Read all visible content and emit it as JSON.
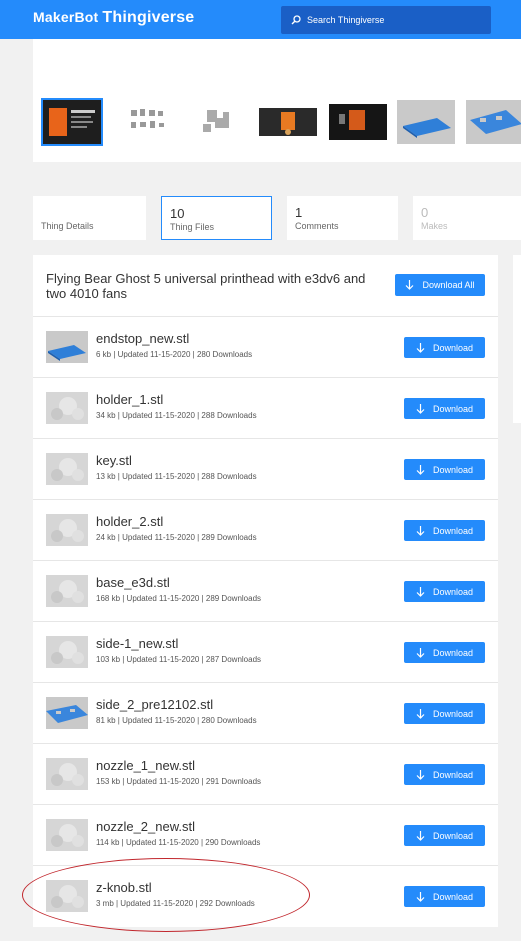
{
  "header": {
    "logo_maker": "MakerBot",
    "logo_thing": "Thingiverse",
    "search_placeholder": "Search Thingiverse",
    "brand_color": "#248bfb"
  },
  "gallery": {
    "thumbnails": [
      "photo-card",
      "parts-grid",
      "parts-render",
      "orange-printhead-photo",
      "printhead-dark-photo",
      "blue-part-render",
      "blue-plate-render"
    ]
  },
  "tabs": [
    {
      "count": "",
      "label": "Thing Details"
    },
    {
      "count": "10",
      "label": "Thing Files"
    },
    {
      "count": "1",
      "label": "Comments"
    },
    {
      "count": "0",
      "label": "Makes"
    }
  ],
  "files": {
    "title": "Flying Bear Ghost 5 universal printhead with e3dv6 and two 4010 fans",
    "download_all_label": "Download All",
    "download_label": "Download",
    "items": [
      {
        "name": "endstop_new.stl",
        "meta": "6 kb | Updated 11-15-2020 | 280 Downloads",
        "thumb": "blue-part"
      },
      {
        "name": "holder_1.stl",
        "meta": "34 kb | Updated 11-15-2020 | 288 Downloads",
        "thumb": "placeholder"
      },
      {
        "name": "key.stl",
        "meta": "13 kb | Updated 11-15-2020 | 288 Downloads",
        "thumb": "placeholder"
      },
      {
        "name": "holder_2.stl",
        "meta": "24 kb | Updated 11-15-2020 | 289 Downloads",
        "thumb": "placeholder"
      },
      {
        "name": "base_e3d.stl",
        "meta": "168 kb | Updated 11-15-2020 | 289 Downloads",
        "thumb": "placeholder"
      },
      {
        "name": "side-1_new.stl",
        "meta": "103 kb | Updated 11-15-2020 | 287 Downloads",
        "thumb": "placeholder"
      },
      {
        "name": "side_2_pre12102.stl",
        "meta": "81 kb | Updated 11-15-2020 | 280 Downloads",
        "thumb": "blue-plate"
      },
      {
        "name": "nozzle_1_new.stl",
        "meta": "153 kb | Updated 11-15-2020 | 291 Downloads",
        "thumb": "placeholder"
      },
      {
        "name": "nozzle_2_new.stl",
        "meta": "114 kb | Updated 11-15-2020 | 290 Downloads",
        "thumb": "placeholder"
      },
      {
        "name": "z-knob.stl",
        "meta": "3 mb | Updated 11-15-2020 | 292 Downloads",
        "thumb": "placeholder"
      }
    ]
  }
}
